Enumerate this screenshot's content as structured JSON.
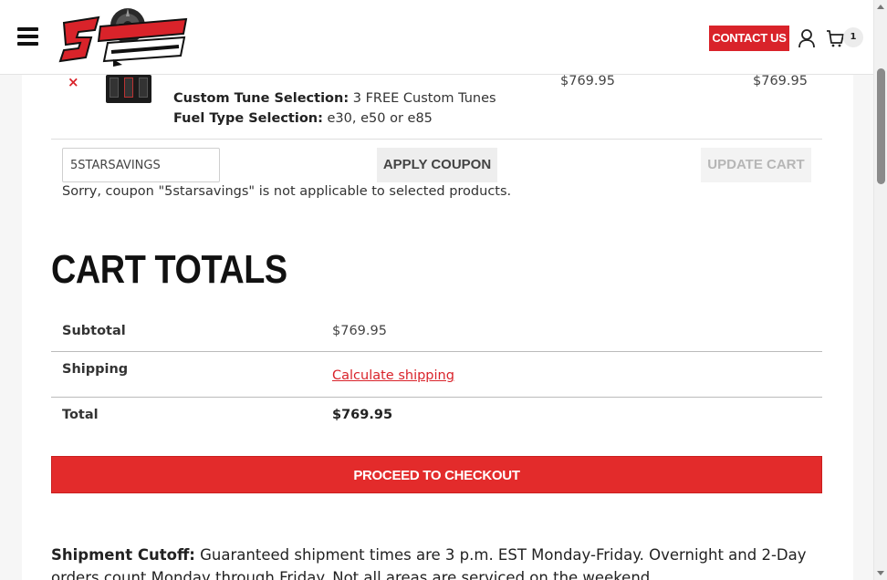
{
  "header": {
    "logo_alt": "5 STAR TUNING",
    "contact_label": "CONTACT US",
    "cart_count": "1",
    "icons": {
      "menu": "hamburger-menu-icon",
      "account": "user-icon",
      "cart": "shopping-cart-icon"
    }
  },
  "cart_item": {
    "remove_symbol": "×",
    "tune_label": "Custom Tune Selection:",
    "tune_value": "3 FREE Custom Tunes",
    "fuel_label": "Fuel Type Selection:",
    "fuel_value": "e30, e50 or e85",
    "price": "$769.95",
    "subtotal": "$769.95"
  },
  "coupon": {
    "value": "5STARSAVINGS",
    "apply_label": "APPLY COUPON",
    "update_label": "UPDATE CART",
    "error": "Sorry, coupon \"5starsavings\" is not applicable to selected products."
  },
  "totals": {
    "title": "CART TOTALS",
    "subtotal_label": "Subtotal",
    "subtotal_value": "$769.95",
    "shipping_label": "Shipping",
    "shipping_link": "Calculate shipping",
    "total_label": "Total",
    "total_value": "$769.95",
    "checkout_label": "PROCEED TO CHECKOUT"
  },
  "cutoff": {
    "label": "Shipment Cutoff:",
    "text": " Guaranteed shipment times are 3 p.m. EST Monday-Friday. Overnight and 2-Day orders count Monday through Friday. Not all areas are serviced on the weekend."
  },
  "colors": {
    "brand_red": "#d9232a",
    "checkout_red": "#e32b2b",
    "link_red": "#d9232a"
  }
}
